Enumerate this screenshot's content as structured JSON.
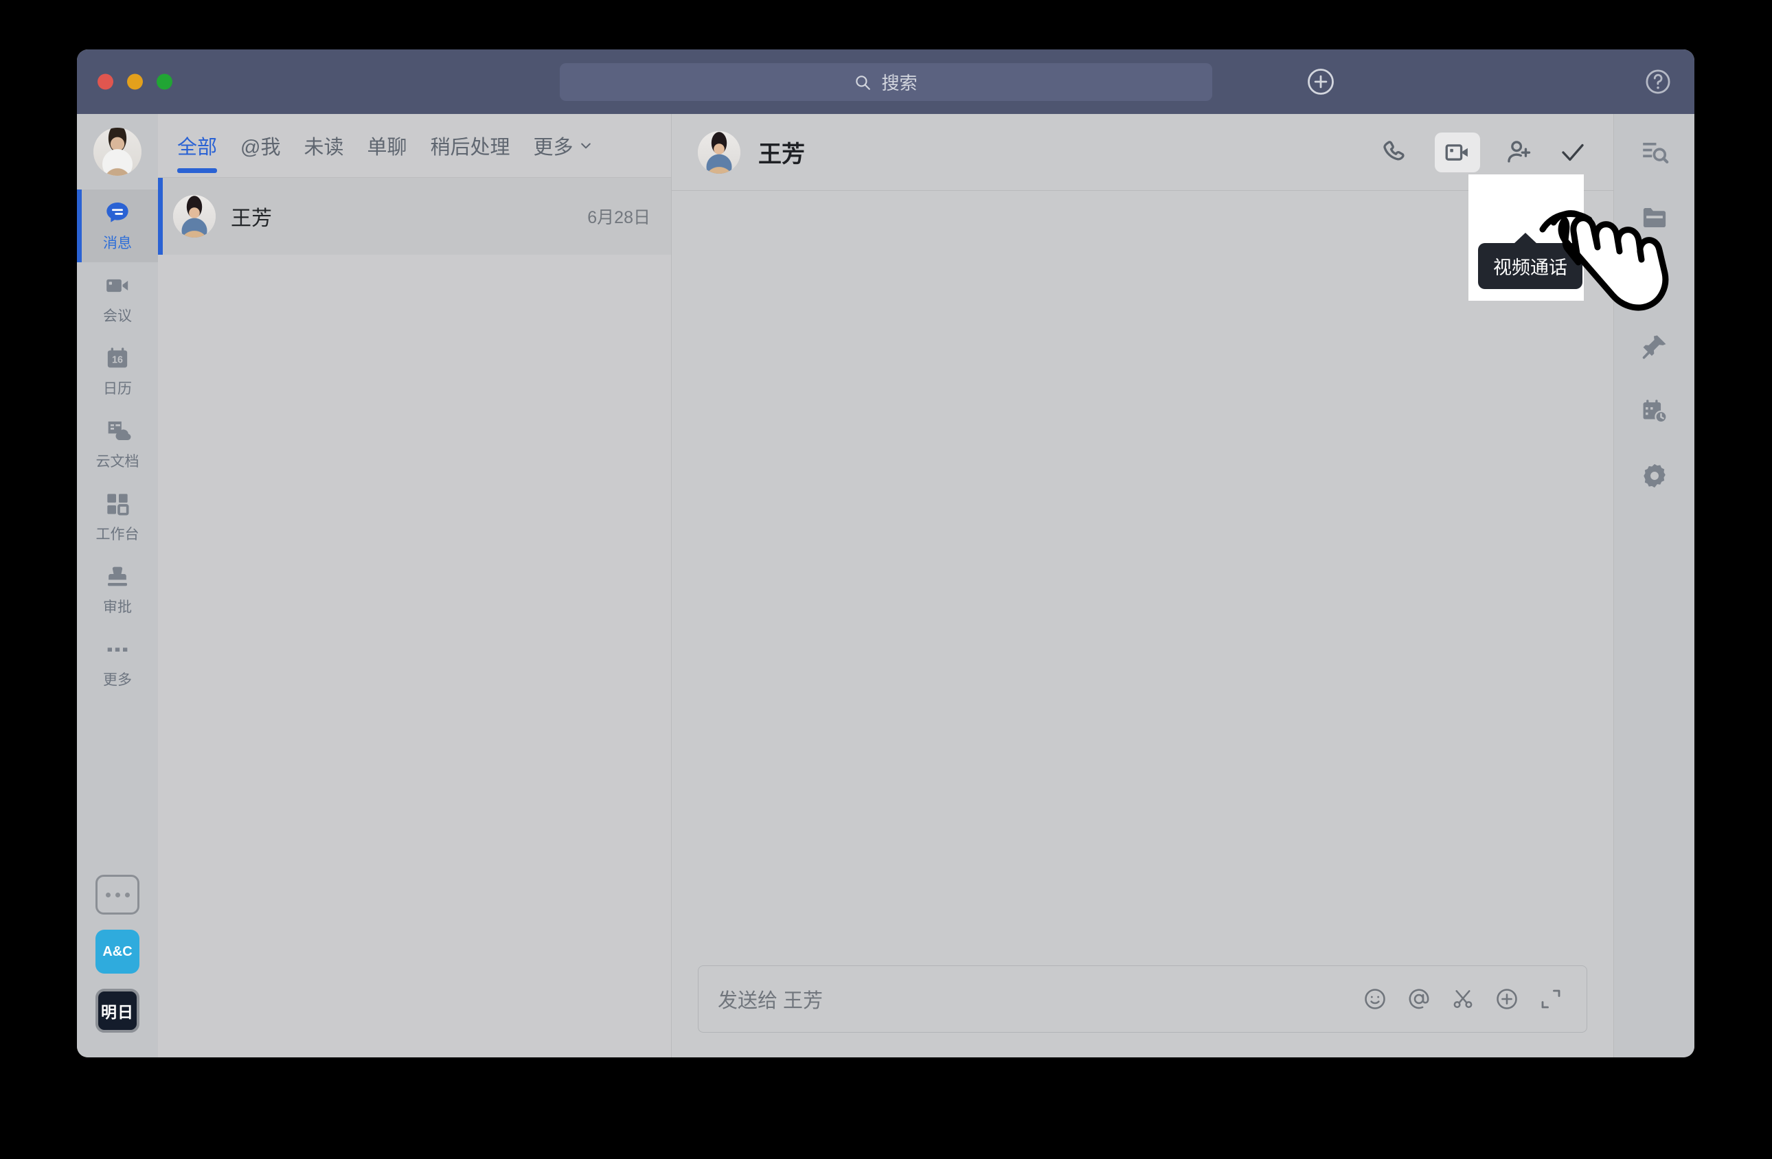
{
  "window": {
    "traffic_lights": [
      "close",
      "minimize",
      "maximize"
    ],
    "accent_blue": "#2a62d4",
    "titlebar_color": "#4e5570",
    "app_background": "#c9cacc"
  },
  "titlebar": {
    "search_placeholder": "搜索",
    "search_icon": "search-icon",
    "add_icon": "plus-circle-icon",
    "help_icon": "question-circle-icon"
  },
  "left_rail": {
    "avatar": "user-avatar",
    "items": [
      {
        "label": "消息",
        "icon": "chat-bubble-icon",
        "active": true
      },
      {
        "label": "会议",
        "icon": "video-camera-icon",
        "active": false
      },
      {
        "label": "日历",
        "icon": "calendar-16-icon",
        "active": false
      },
      {
        "label": "云文档",
        "icon": "cloud-document-icon",
        "active": false
      },
      {
        "label": "工作台",
        "icon": "grid-apps-icon",
        "active": false
      },
      {
        "label": "审批",
        "icon": "stamp-icon",
        "active": false
      },
      {
        "label": "更多",
        "icon": "ellipsis-icon",
        "active": false
      }
    ],
    "bottom": {
      "more_box_icon": "ellipsis-box-icon",
      "app_tiles": [
        {
          "name": "A&C",
          "label": "A&C",
          "color": "#2fabdd"
        },
        {
          "name": "明日",
          "label": "明日",
          "color": "#141c2b"
        }
      ]
    }
  },
  "chat_list": {
    "tabs": [
      {
        "label": "全部",
        "active": true
      },
      {
        "label": "@我",
        "active": false
      },
      {
        "label": "未读",
        "active": false
      },
      {
        "label": "单聊",
        "active": false
      },
      {
        "label": "稍后处理",
        "active": false
      },
      {
        "label": "更多",
        "active": false,
        "icon": "chevron-down-icon"
      }
    ],
    "items": [
      {
        "name": "王芳",
        "time": "6月28日",
        "selected": true
      }
    ]
  },
  "conversation": {
    "title": "王芳",
    "avatar": "contact-avatar",
    "actions": [
      {
        "name": "voice-call",
        "icon": "phone-icon"
      },
      {
        "name": "video-call",
        "icon": "video-call-icon",
        "highlighted": true
      },
      {
        "name": "add-member",
        "icon": "add-person-icon"
      },
      {
        "name": "mark-done",
        "icon": "check-icon"
      }
    ],
    "tooltip": {
      "text": "视频通话",
      "for": "video-call"
    },
    "cursor": "pointing-hand-cursor",
    "composer": {
      "placeholder": "发送给 王芳",
      "icons": [
        {
          "name": "emoji",
          "icon": "smiley-icon"
        },
        {
          "name": "mention",
          "icon": "at-icon"
        },
        {
          "name": "screenshot",
          "icon": "scissors-icon"
        },
        {
          "name": "more-attach",
          "icon": "plus-circle-icon"
        },
        {
          "name": "expand",
          "icon": "expand-icon"
        }
      ]
    }
  },
  "right_rail": {
    "items": [
      {
        "name": "search-in-chat",
        "icon": "list-search-icon"
      },
      {
        "name": "files",
        "icon": "folder-icon"
      },
      {
        "name": "highlight",
        "icon": "marker-pen-icon"
      },
      {
        "name": "pinned",
        "icon": "pin-icon"
      },
      {
        "name": "reminders",
        "icon": "calendar-clock-icon"
      },
      {
        "name": "settings",
        "icon": "gear-icon"
      }
    ]
  }
}
